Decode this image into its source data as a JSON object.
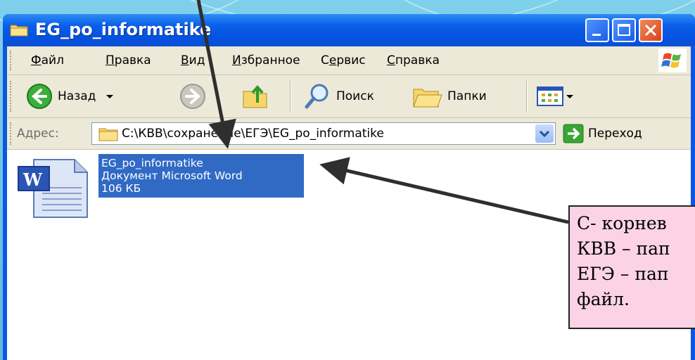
{
  "window": {
    "title": "EG_po_informatike"
  },
  "menu": [
    "Файл",
    "Правка",
    "Вид",
    "Избранное",
    "Сервис",
    "Справка"
  ],
  "menu_underline": [
    "Ф",
    "П",
    "В",
    "И",
    "е",
    "С"
  ],
  "toolbar": {
    "back_label": "Назад",
    "search_label": "Поиск",
    "folders_label": "Папки"
  },
  "address": {
    "label": "Адрес:",
    "value": "C:\\КВВ\\сохранение\\ЕГЭ\\EG_po_informatike",
    "go_label": "Переход"
  },
  "file": {
    "name": "EG_po_informatike",
    "type": "Документ Microsoft Word",
    "size": "106 КБ"
  },
  "callout": {
    "lines": [
      "C- корнев",
      "КВВ – пап",
      "ЕГЭ – пап",
      "файл."
    ]
  },
  "colors": {
    "titlebar": "#0a5fe9",
    "selection": "#316ac5",
    "callout_bg": "#fbd3e4",
    "chrome": "#ece9d8"
  },
  "icons": [
    "folder-icon",
    "back-arrow-icon",
    "forward-arrow-icon",
    "up-folder-icon",
    "search-icon",
    "folders-icon",
    "views-icon",
    "go-arrow-icon",
    "word-document-icon"
  ]
}
